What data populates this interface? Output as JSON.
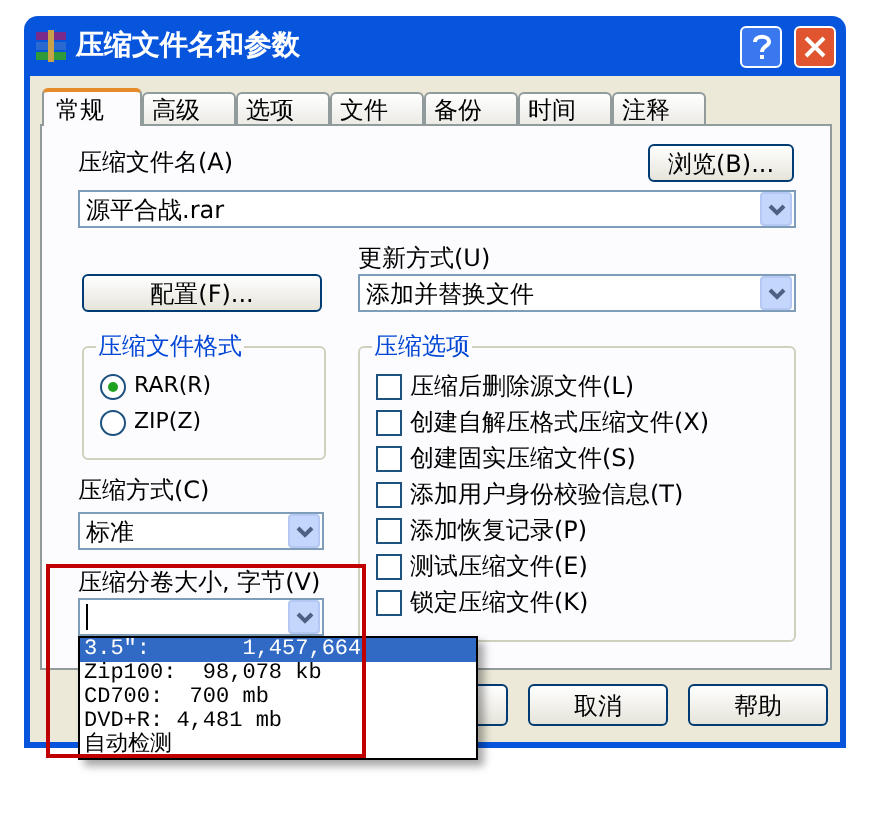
{
  "window": {
    "title": "压缩文件名和参数"
  },
  "tabs": [
    {
      "label": "常规",
      "selected": true
    },
    {
      "label": "高级",
      "selected": false
    },
    {
      "label": "选项",
      "selected": false
    },
    {
      "label": "文件",
      "selected": false
    },
    {
      "label": "备份",
      "selected": false
    },
    {
      "label": "时间",
      "selected": false
    },
    {
      "label": "注释",
      "selected": false
    }
  ],
  "archive_name": {
    "label": "压缩文件名(A)",
    "value": "源平合战.rar"
  },
  "browse_button": "浏览(B)...",
  "update_mode": {
    "label": "更新方式(U)",
    "value": "添加并替换文件"
  },
  "config_button": "配置(F)...",
  "format_group": {
    "title": "压缩文件格式",
    "options": [
      {
        "label": "RAR(R)",
        "selected": true
      },
      {
        "label": "ZIP(Z)",
        "selected": false
      }
    ]
  },
  "method": {
    "label": "压缩方式(C)",
    "value": "标准"
  },
  "volume_size": {
    "label": "压缩分卷大小, 字节(V)",
    "options": [
      {
        "label": "3.5\":       1,457,664",
        "selected": true
      },
      {
        "label": "Zip100:  98,078 kb",
        "selected": false
      },
      {
        "label": "CD700:  700 mb",
        "selected": false
      },
      {
        "label": "DVD+R: 4,481 mb",
        "selected": false
      },
      {
        "label": "自动检测",
        "selected": false
      }
    ]
  },
  "options_group": {
    "title": "压缩选项",
    "options": [
      {
        "label": "压缩后删除源文件(L)",
        "checked": false
      },
      {
        "label": "创建自解压格式压缩文件(X)",
        "checked": false
      },
      {
        "label": "创建固实压缩文件(S)",
        "checked": false
      },
      {
        "label": "添加用户身份校验信息(T)",
        "checked": false
      },
      {
        "label": "添加恢复记录(P)",
        "checked": false
      },
      {
        "label": "测试压缩文件(E)",
        "checked": false
      },
      {
        "label": "锁定压缩文件(K)",
        "checked": false
      }
    ]
  },
  "buttons": [
    {
      "label": "取消"
    },
    {
      "label": "帮助"
    }
  ]
}
